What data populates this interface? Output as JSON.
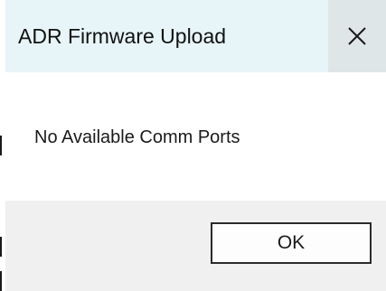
{
  "window": {
    "title": "ADR Firmware Upload",
    "close_icon": "close-icon"
  },
  "dialog": {
    "message": "No Available Comm Ports",
    "ok_label": "OK"
  },
  "colors": {
    "titlebar_bg": "#e8f5f8",
    "close_button_bg": "#dfe6e8",
    "content_bg": "#ffffff",
    "footer_bg": "#f0f0f0"
  }
}
